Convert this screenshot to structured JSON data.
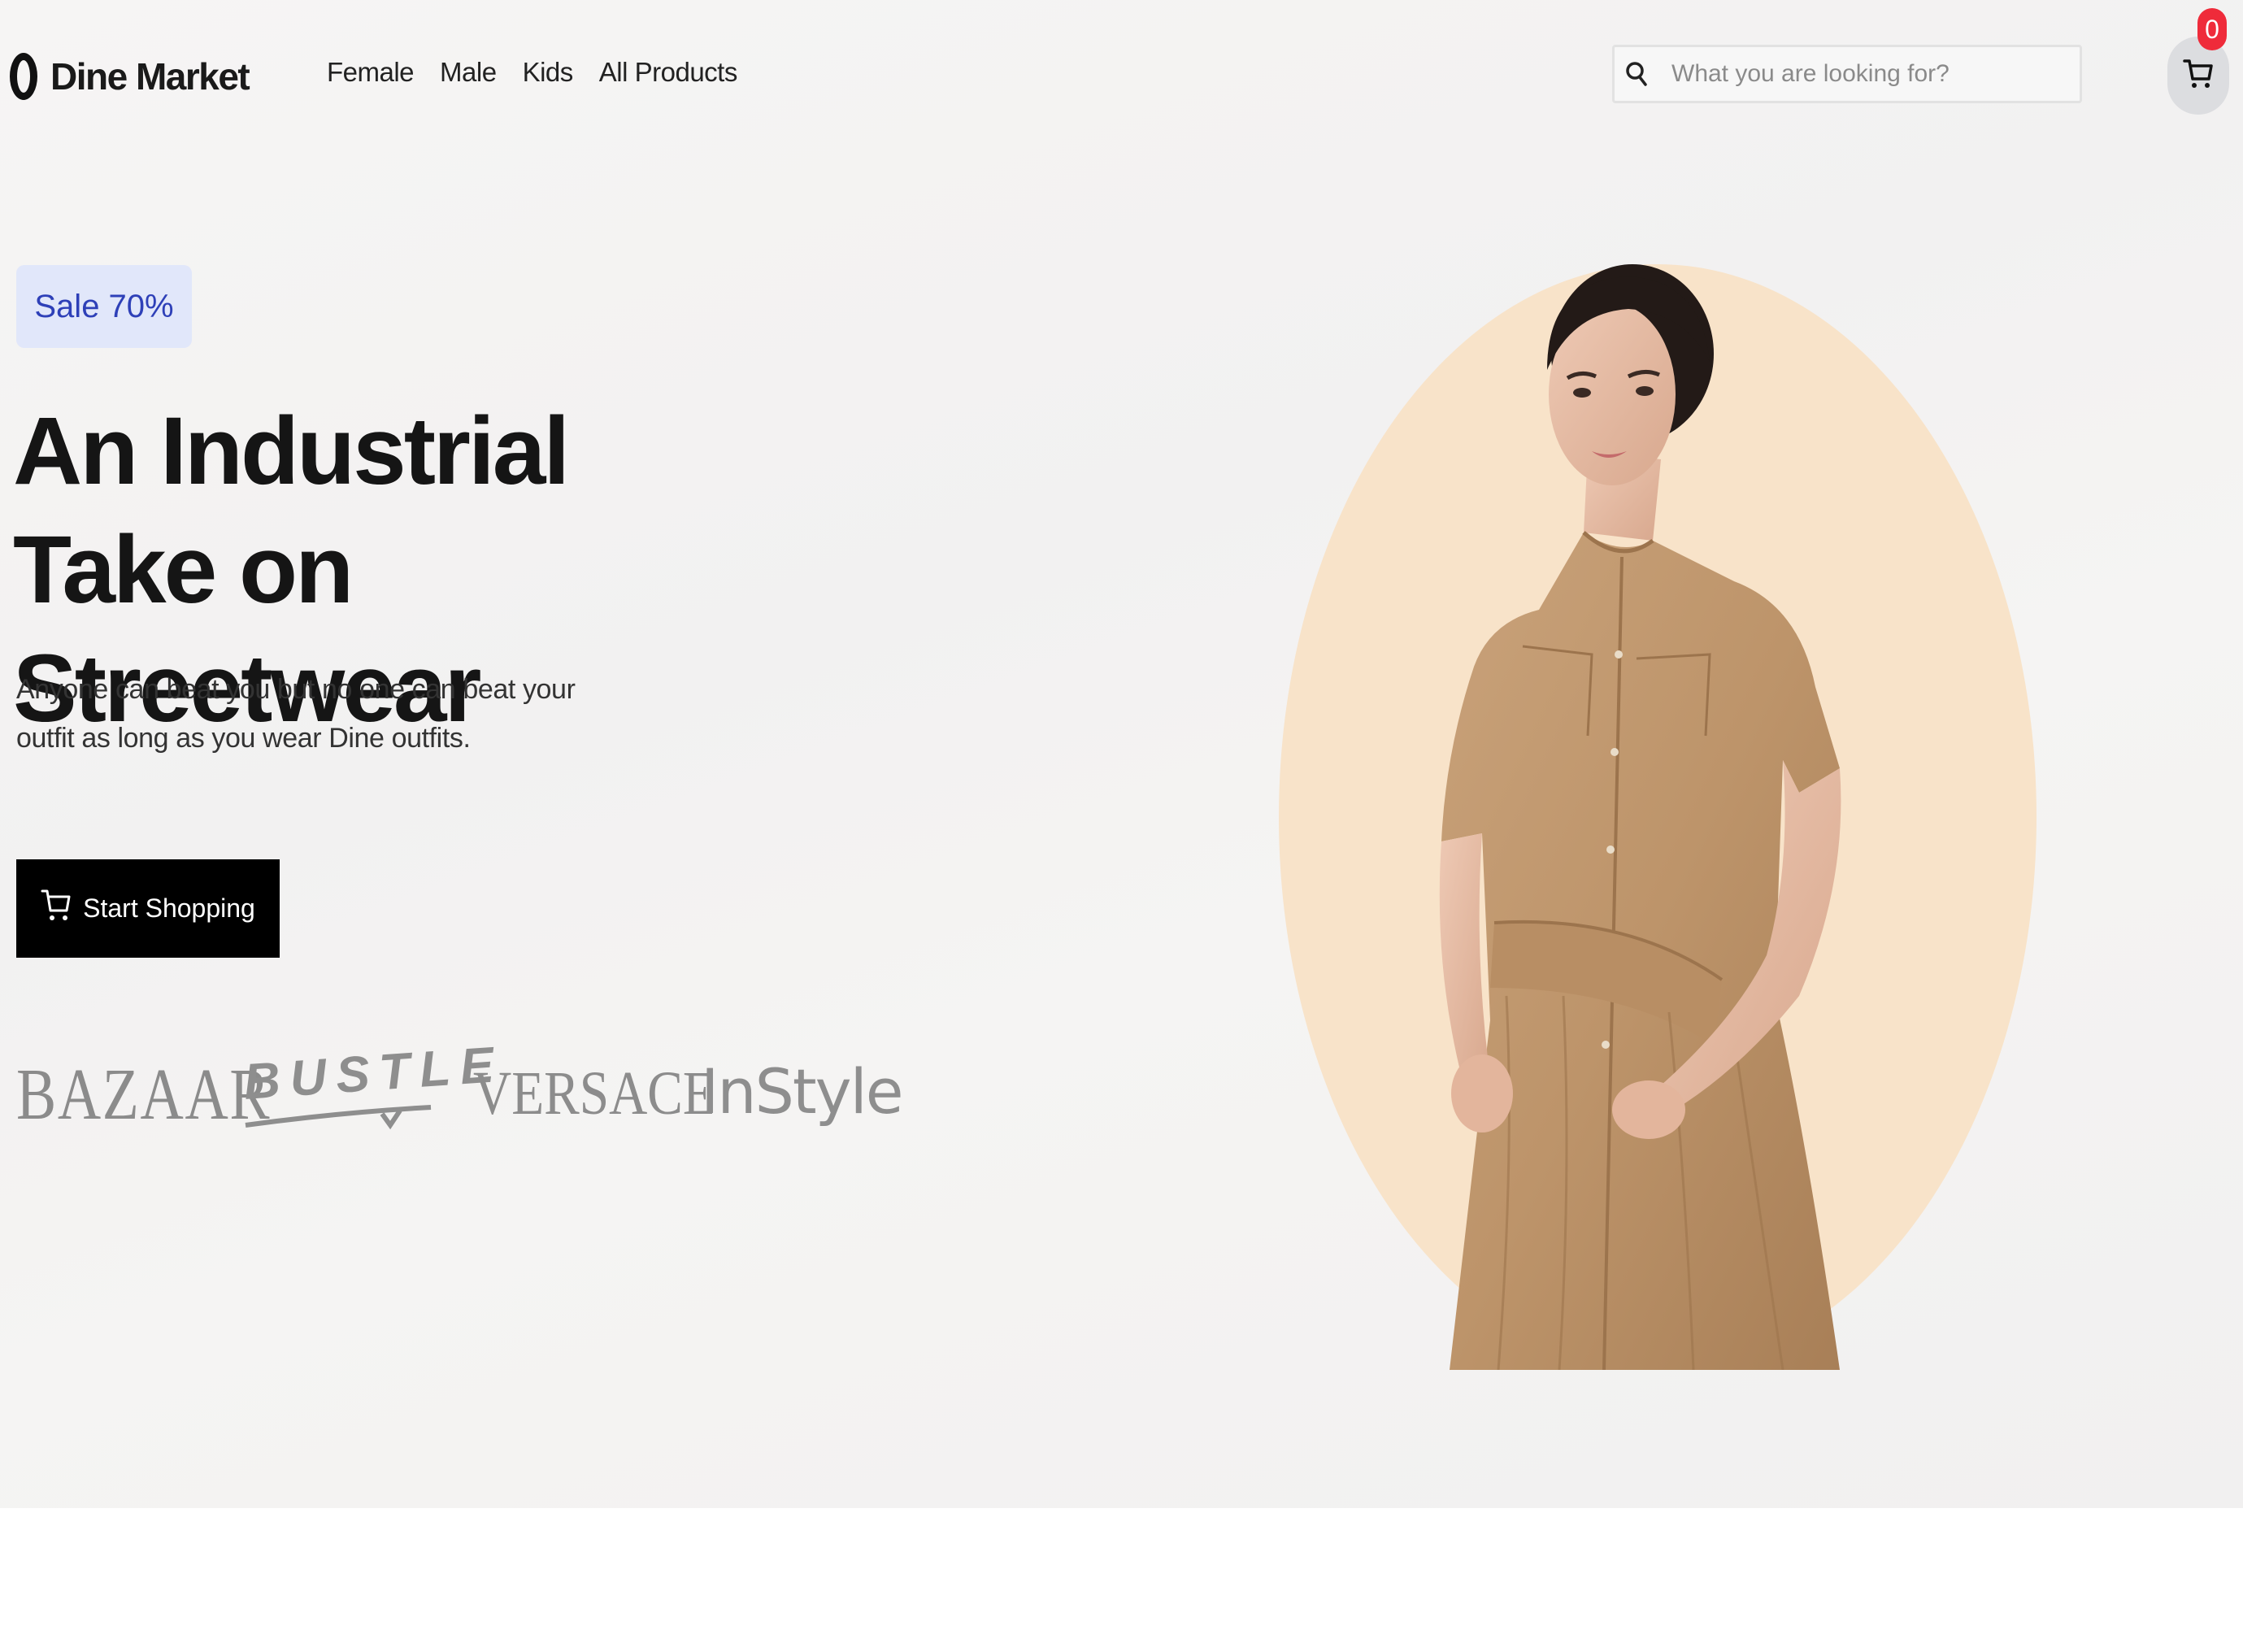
{
  "header": {
    "logo_text": "Dine Market",
    "nav": [
      "Female",
      "Male",
      "Kids",
      "All Products"
    ],
    "search": {
      "placeholder": "What you are looking for?",
      "icon": "search-icon"
    },
    "cart": {
      "icon": "cart-icon",
      "count": "0"
    }
  },
  "hero": {
    "badge": "Sale 70%",
    "title": "An Industrial Take on Streetwear",
    "description": "Anyone can beat you but no one can beat your outfit as long as you wear Dine outfits.",
    "cta_label": "Start Shopping",
    "cta_icon": "cart-icon",
    "brands": [
      "BAZAAR",
      "BUSTLE",
      "VERSACE",
      "InStyle"
    ],
    "image": "woman-in-tan-dress"
  },
  "colors": {
    "background": "#f5f4f3",
    "badge_bg": "#e1e7fa",
    "badge_text": "#2e40b8",
    "cta_bg": "#000000",
    "circle": "#f8e3c9",
    "cart_badge": "#ef2b3a",
    "brand_gray": "#8e8e8e"
  }
}
